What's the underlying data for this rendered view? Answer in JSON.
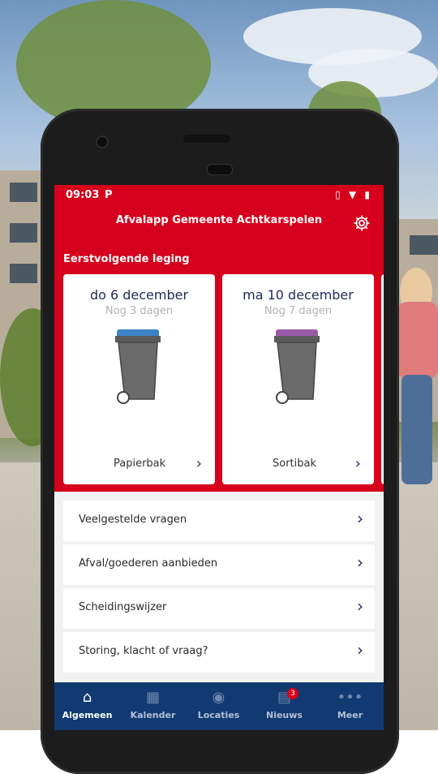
{
  "status_bar": {
    "time": "09:03",
    "app_icon": "P",
    "system_icons": [
      "vibrate-icon",
      "wifi-icon",
      "battery-icon"
    ]
  },
  "app_bar": {
    "title": "Afvalapp Gemeente Achtkarspelen",
    "settings_icon": "gear-icon"
  },
  "collection": {
    "heading": "Eerstvolgende leging",
    "cards": [
      {
        "date": "do 6 december",
        "days": "Nog 3 dagen",
        "bin": "Papierbak",
        "lid_color": "#3b83c6"
      },
      {
        "date": "ma 10 december",
        "days": "Nog 7 dagen",
        "bin": "Sortibak",
        "lid_color": "#9a5aa8"
      }
    ]
  },
  "menu": {
    "items": [
      "Veelgestelde vragen",
      "Afval/goederen aanbieden",
      "Scheidingswijzer",
      "Storing, klacht of vraag?"
    ]
  },
  "tabs": [
    {
      "label": "Algemeen",
      "icon": "home-icon",
      "active": true
    },
    {
      "label": "Kalender",
      "icon": "calendar-icon",
      "active": false
    },
    {
      "label": "Locaties",
      "icon": "location-pin-icon",
      "active": false
    },
    {
      "label": "Nieuws",
      "icon": "news-icon",
      "badge": "3",
      "active": false
    },
    {
      "label": "Meer",
      "icon": "more-icon",
      "active": false
    }
  ],
  "colors": {
    "brand_red": "#d6001c",
    "nav_blue": "#123a72",
    "text_blue": "#1f2a5a"
  }
}
